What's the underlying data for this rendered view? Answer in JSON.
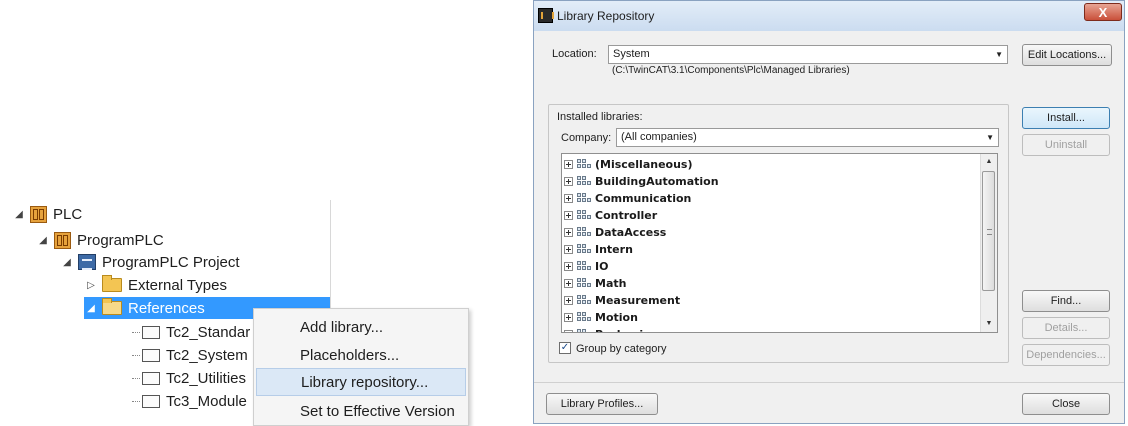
{
  "tree": {
    "plc": "PLC",
    "program_plc": "ProgramPLC",
    "project": "ProgramPLC Project",
    "external_types": "External Types",
    "references": "References",
    "libs": [
      "Tc2_Standar",
      "Tc2_System",
      "Tc2_Utilities",
      "Tc3_Module"
    ]
  },
  "context_menu": {
    "items": [
      "Add library...",
      "Placeholders...",
      "Library repository...",
      "Set to Effective Version"
    ],
    "highlighted_index": 2
  },
  "dialog": {
    "title": "Library Repository",
    "close_label": "X",
    "location_label": "Location:",
    "location_value": "System",
    "location_path": "(C:\\TwinCAT\\3.1\\Components\\Plc\\Managed Libraries)",
    "edit_locations": "Edit Locations...",
    "installed_label": "Installed libraries:",
    "company_label": "Company:",
    "company_value": "(All companies)",
    "categories": [
      "(Miscellaneous)",
      "BuildingAutomation",
      "Communication",
      "Controller",
      "DataAccess",
      "Intern",
      "IO",
      "Math",
      "Measurement",
      "Motion",
      "Packaging"
    ],
    "group_by_category": "Group by category",
    "buttons": {
      "install": "Install...",
      "uninstall": "Uninstall",
      "find": "Find...",
      "details": "Details...",
      "dependencies": "Dependencies...",
      "library_profiles": "Library Profiles...",
      "close": "Close"
    }
  },
  "colors": {
    "selection_blue": "#3399ff",
    "menu_highlight": "#dbe8f6",
    "dialog_bg": "#f0f0f0"
  }
}
